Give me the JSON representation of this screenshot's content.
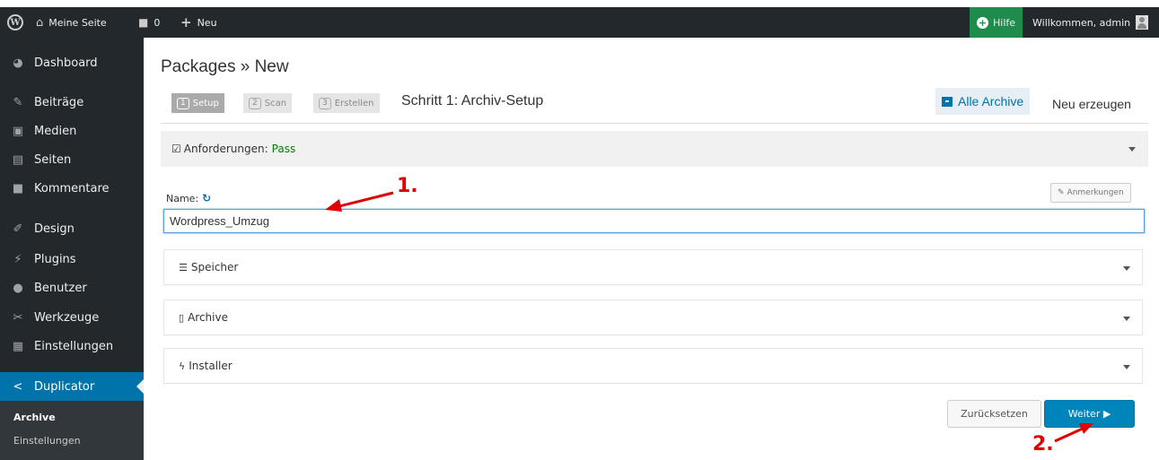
{
  "adminbar": {
    "site_name": "Meine Seite",
    "comments_count": "0",
    "new_label": "Neu",
    "help_label": "Hilfe",
    "welcome": "Willkommen, admin"
  },
  "sidebar": {
    "items": [
      {
        "label": "Dashboard",
        "icon": "dashboard-icon"
      },
      {
        "label": "Beiträge",
        "icon": "pin-icon"
      },
      {
        "label": "Medien",
        "icon": "media-icon"
      },
      {
        "label": "Seiten",
        "icon": "pages-icon"
      },
      {
        "label": "Kommentare",
        "icon": "comment-icon"
      },
      {
        "label": "Design",
        "icon": "brush-icon"
      },
      {
        "label": "Plugins",
        "icon": "plugin-icon"
      },
      {
        "label": "Benutzer",
        "icon": "user-icon"
      },
      {
        "label": "Werkzeuge",
        "icon": "wrench-icon"
      },
      {
        "label": "Einstellungen",
        "icon": "settings-icon"
      },
      {
        "label": "Duplicator",
        "icon": "share-icon"
      }
    ],
    "submenu": [
      "Archive",
      "Einstellungen"
    ]
  },
  "main": {
    "title": "Packages » New",
    "steps": [
      {
        "num": "1",
        "label": "Setup"
      },
      {
        "num": "2",
        "label": "Scan"
      },
      {
        "num": "3",
        "label": "Erstellen"
      }
    ],
    "step_title": "Schritt 1: Archiv-Setup",
    "all_archives": "Alle Archive",
    "new_create": "Neu erzeugen",
    "requirements_label": "Anforderungen:",
    "requirements_status": "Pass",
    "name_label": "Name:",
    "notes_button": "Anmerkungen",
    "name_value": "Wordpress_Umzug",
    "panels": [
      {
        "label": "Speicher",
        "icon": "database-icon"
      },
      {
        "label": "Archive",
        "icon": "file-archive-icon"
      },
      {
        "label": "Installer",
        "icon": "bolt-icon"
      }
    ],
    "reset_button": "Zurücksetzen",
    "next_button": "Weiter ▶"
  },
  "annotations": {
    "label1": "1.",
    "label2": "2.",
    "color": "#e00000"
  },
  "colors": {
    "accent": "#0073aa",
    "adminbar_bg": "#23282d",
    "pass": "#008000",
    "help_bg": "#1e8c4a"
  }
}
